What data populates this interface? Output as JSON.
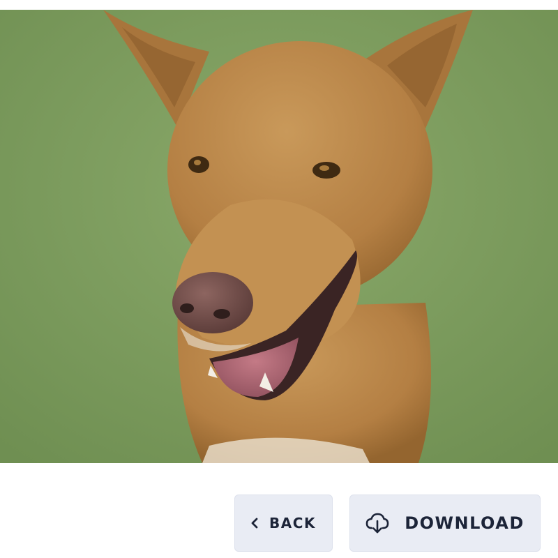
{
  "photo": {
    "subject": "dog",
    "colors": {
      "grass": "#7e9d5e",
      "fur": "#b98648",
      "nose": "#6e4a45",
      "tongue": "#a86470"
    }
  },
  "actions": {
    "back": {
      "label": "BACK",
      "icon": "chevron-left-icon"
    },
    "download": {
      "label": "DOWNLOAD",
      "icon": "cloud-download-icon"
    }
  },
  "colors": {
    "button_bg": "#e9ecf4",
    "button_text": "#1c2438"
  }
}
